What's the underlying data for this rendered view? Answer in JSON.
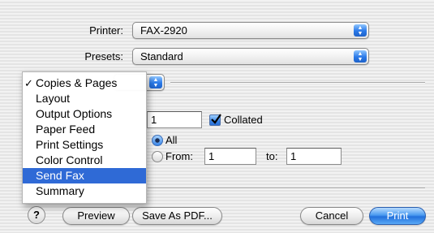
{
  "printer": {
    "label": "Printer:",
    "value": "FAX-2920"
  },
  "presets": {
    "label": "Presets:",
    "value": "Standard"
  },
  "pane_menu": {
    "items": [
      {
        "label": "Copies & Pages",
        "checked": true,
        "selected": false
      },
      {
        "label": "Layout",
        "checked": false,
        "selected": false
      },
      {
        "label": "Output Options",
        "checked": false,
        "selected": false
      },
      {
        "label": "Paper Feed",
        "checked": false,
        "selected": false
      },
      {
        "label": "Print Settings",
        "checked": false,
        "selected": false
      },
      {
        "label": "Color Control",
        "checked": false,
        "selected": false
      },
      {
        "label": "Send Fax",
        "checked": false,
        "selected": true
      },
      {
        "label": "Summary",
        "checked": false,
        "selected": false
      }
    ],
    "check_mark": "✓"
  },
  "copies": {
    "value": "1",
    "collated_label": "Collated",
    "collated": true
  },
  "pages": {
    "all_label": "All",
    "from_label": "From:",
    "from_value": "1",
    "to_label": "to:",
    "to_value": "1",
    "selection": "All"
  },
  "buttons": {
    "help": "?",
    "preview": "Preview",
    "save_as_pdf": "Save As PDF...",
    "cancel": "Cancel",
    "print": "Print"
  },
  "colors": {
    "accent": "#2f6ad6",
    "default_button": "#2270dc"
  }
}
